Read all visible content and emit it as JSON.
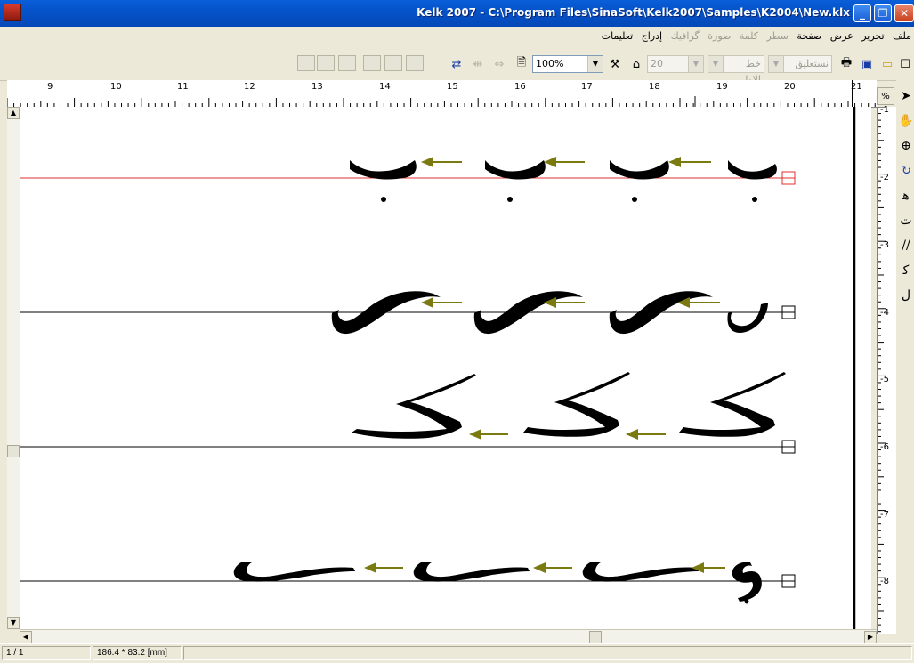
{
  "window": {
    "title": "Kelk 2007 - C:\\Program Files\\SinaSoft\\Kelk2007\\Samples\\K2004\\New.klx",
    "app_icon_label": "2007"
  },
  "menu": [
    {
      "label": "ملف",
      "enabled": true
    },
    {
      "label": "تحرير",
      "enabled": true
    },
    {
      "label": "عرض",
      "enabled": true
    },
    {
      "label": "صفحة",
      "enabled": true
    },
    {
      "label": "سطر",
      "enabled": false
    },
    {
      "label": "كلمة",
      "enabled": false
    },
    {
      "label": "صورة",
      "enabled": false
    },
    {
      "label": "گرافيك",
      "enabled": false
    },
    {
      "label": "إدراج",
      "enabled": true
    },
    {
      "label": "تعليمات",
      "enabled": true
    }
  ],
  "toolbar": {
    "zoom_value": "100%",
    "font_size_value": "20",
    "style_value": "خط الاول",
    "font_value": "نستعليق"
  },
  "ruler": {
    "h_labels": [
      "9",
      "10",
      "11",
      "12",
      "13",
      "14",
      "15",
      "16",
      "17",
      "18",
      "19",
      "20",
      "21"
    ],
    "v_labels": [
      "-1",
      "-2",
      "-3",
      "-4",
      "-5",
      "-6",
      "-7",
      "-8"
    ],
    "corner_label": "%"
  },
  "canvas": {
    "rows": [
      {
        "letter": "ب",
        "line_color": "#e03030"
      },
      {
        "letter": "س",
        "line_color": "#000000"
      },
      {
        "letter": "ک",
        "line_color": "#000000"
      },
      {
        "letter": "ی",
        "line_color": "#000000"
      }
    ],
    "arrow_color": "#7a7a10"
  },
  "tools": [
    "pointer-icon",
    "hand-icon",
    "zoom-icon",
    "rotate-icon",
    "kashida-icon",
    "letter-icon",
    "slant-icon",
    "stroke-icon",
    "ligature-icon"
  ],
  "status": {
    "page": "1 / 1",
    "size": "186.4 * 83.2 [mm]"
  }
}
